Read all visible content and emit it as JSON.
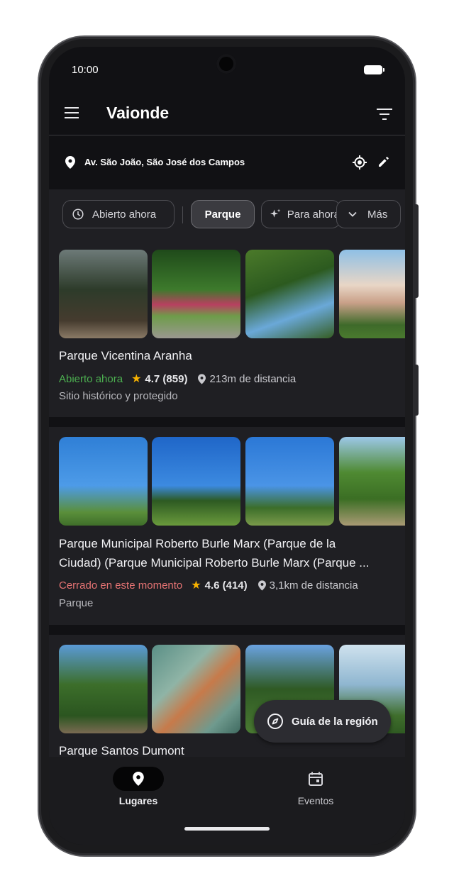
{
  "status_bar": {
    "time": "10:00"
  },
  "app": {
    "title": "Vaionde"
  },
  "location": {
    "address": "Av. São João, São José dos Campos"
  },
  "filters": {
    "open_now": "Abierto ahora",
    "park": "Parque",
    "for_now": "Para ahora",
    "more": "Más"
  },
  "places": [
    {
      "name": "Parque Vicentina Aranha",
      "status": "Abierto ahora",
      "rating": "4.7 (859)",
      "distance": "213m de distancia",
      "category": "Sitio histórico y protegido"
    },
    {
      "name_line1": "Parque Municipal Roberto Burle Marx (Parque de la",
      "name_line2": "Ciudad) (Parque Municipal Roberto Burle Marx (Parque ...",
      "status": "Cerrado en este momento",
      "rating": "4.6 (414)",
      "distance": "3,1km de distancia",
      "category": "Parque"
    },
    {
      "name": "Parque Santos Dumont"
    }
  ],
  "fab": {
    "label": "Guía de la región"
  },
  "nav": {
    "places": "Lugares",
    "events": "Eventos"
  },
  "colors": {
    "background": "#111114",
    "card": "#1f1f23",
    "open": "#4caf50",
    "closed": "#e57373",
    "star": "#f6b100"
  }
}
